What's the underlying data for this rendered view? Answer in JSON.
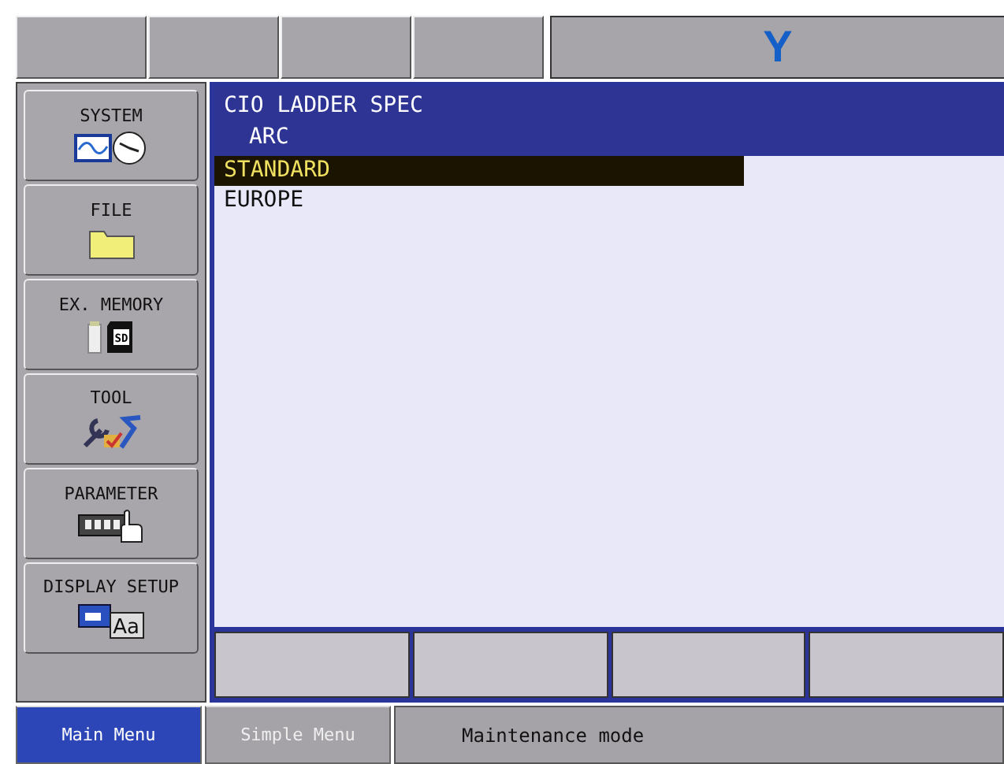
{
  "header": {
    "logo": "Y"
  },
  "side_menu": [
    {
      "label": "SYSTEM",
      "kind": "system"
    },
    {
      "label": "FILE",
      "kind": "file"
    },
    {
      "label": "EX. MEMORY",
      "kind": "memory",
      "icon_text": "SD"
    },
    {
      "label": "TOOL",
      "kind": "tool"
    },
    {
      "label": "PARAMETER",
      "kind": "parameter"
    },
    {
      "label": "DISPLAY SETUP",
      "kind": "display",
      "icon_text": "Aa"
    }
  ],
  "panel": {
    "title": "CIO LADDER SPEC",
    "subtitle": "ARC",
    "items": [
      {
        "label": "STANDARD",
        "selected": true
      },
      {
        "label": "EUROPE",
        "selected": false
      }
    ]
  },
  "bottom_tabs": [
    {
      "label": "Main Menu",
      "selected": true
    },
    {
      "label": "Simple Menu",
      "selected": false
    }
  ],
  "status": "Maintenance mode"
}
